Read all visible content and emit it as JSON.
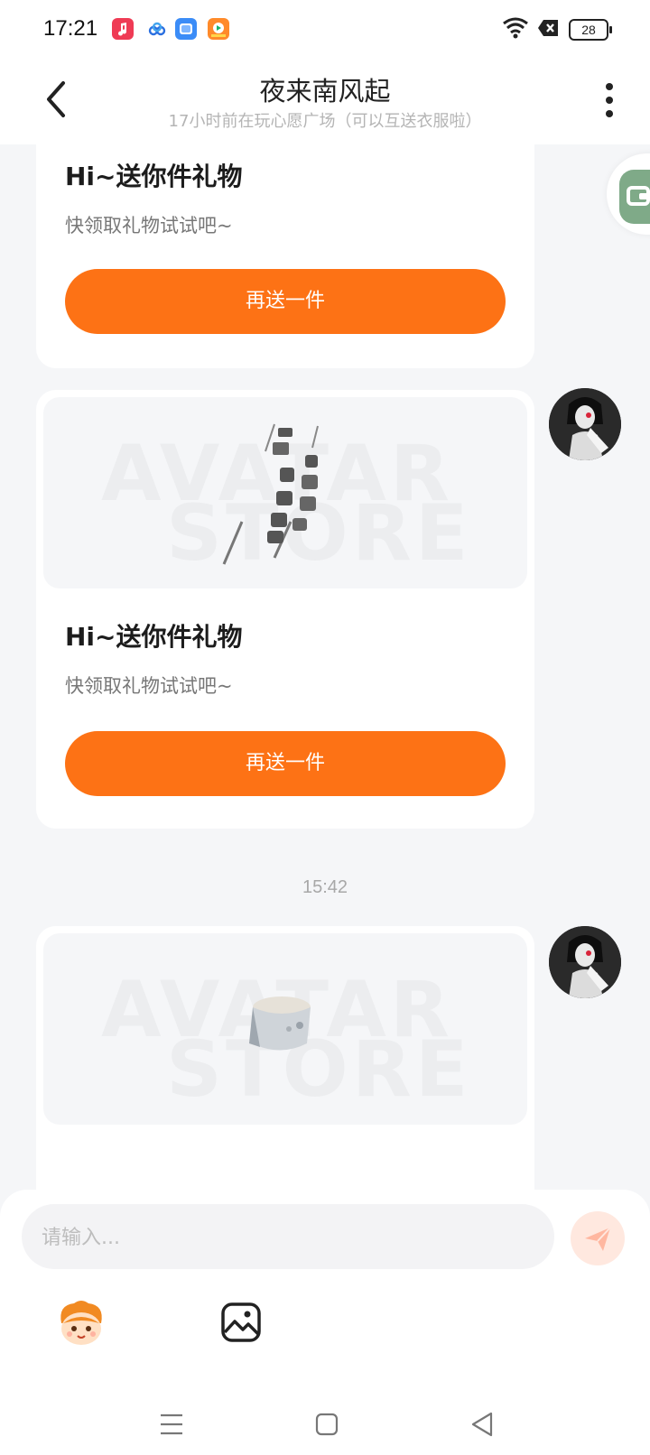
{
  "status_bar": {
    "time": "17:21",
    "battery": "28",
    "icons": [
      "music-app-icon",
      "cloud-app-icon",
      "gallery-app-icon",
      "video-app-icon",
      "wifi-icon",
      "notification-x-icon",
      "battery-icon"
    ]
  },
  "header": {
    "title": "夜来南风起",
    "subtitle": "17小时前在玩心愿广场（可以互送衣服啦）",
    "back_icon": "chevron-left-icon",
    "more_icon": "more-vertical-icon"
  },
  "messages": [
    {
      "type": "gift-card",
      "title": "Hi~送你件礼物",
      "subtitle": "快领取礼物试试吧~",
      "button": "再送一件"
    },
    {
      "type": "gift-card",
      "watermark_top": "AVATAR",
      "watermark_bottom": "STORE",
      "title": "Hi~送你件礼物",
      "subtitle": "快领取礼物试试吧~",
      "button": "再送一件"
    },
    {
      "type": "timestamp",
      "text": "15:42"
    },
    {
      "type": "gift-card",
      "watermark_top": "AVATAR",
      "watermark_bottom": "STORE"
    }
  ],
  "input": {
    "placeholder": "请输入..."
  },
  "colors": {
    "accent": "#fd7215",
    "background": "#f5f6f8",
    "send_button": "#ffe8df",
    "float_tab": "#7faa88"
  }
}
